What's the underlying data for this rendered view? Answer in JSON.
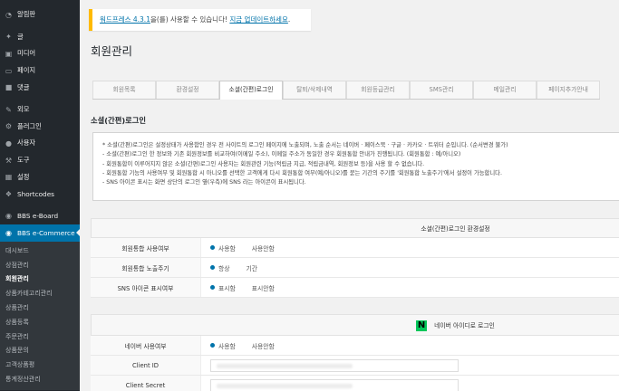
{
  "sidebar": {
    "top_items": [
      {
        "label": "알림판",
        "icon": "dashboard-icon"
      }
    ],
    "items": [
      {
        "label": "글",
        "icon": "pin-icon"
      },
      {
        "label": "미디어",
        "icon": "media-icon"
      },
      {
        "label": "페이지",
        "icon": "page-icon"
      },
      {
        "label": "댓글",
        "icon": "comment-icon"
      }
    ],
    "items2": [
      {
        "label": "외모",
        "icon": "brush-icon"
      },
      {
        "label": "플러그인",
        "icon": "plugin-icon"
      },
      {
        "label": "사용자",
        "icon": "user-icon"
      },
      {
        "label": "도구",
        "icon": "wrench-icon"
      },
      {
        "label": "설정",
        "icon": "settings-icon"
      },
      {
        "label": "Shortcodes",
        "icon": "shortcode-icon"
      }
    ],
    "items3": [
      {
        "label": "BBS e-Board",
        "icon": "board-icon"
      },
      {
        "label": "BBS e-Commerce",
        "icon": "commerce-icon"
      }
    ],
    "submenu": [
      "대시보드",
      "상점관리",
      "회원관리",
      "상품카테고리관리",
      "상품관리",
      "상품등록",
      "주문관리",
      "상품문의",
      "고객상품평",
      "통계정산관리"
    ],
    "submenu_current": "회원관리"
  },
  "notice": {
    "link1": "워드프레스 4.3.1",
    "middle": "을(를) 사용할 수 있습니다!",
    "link2": "지금 업데이트하세요",
    "end": "."
  },
  "page_title": "회원관리",
  "tabs": [
    "회원목록",
    "환경설정",
    "소셜(간편)로그인",
    "탈퇴/삭제내역",
    "회원등급관리",
    "SMS관리",
    "메일관리",
    "페이지추가안내"
  ],
  "active_tab": "소셜(간편)로그인",
  "section_title": "소셜(간편)로그인",
  "description": [
    "* 소셜(간편)로그인은 설정상태가 사용함인 경우 전 사이트의 로그인 페이지에 노출되며, 노출 순서는 네이버 · 페이스북 · 구글 · 카카오 · 트위터 순입니다. (순서변경 불가)",
    "- 소셜(간편)로그인 한 정보와 기존 회원정보를 비교하여(이메일 주소), 이메일 주소가 동일한 경우 회원통합 안내가 진행됩니다. (회원통합 : 예/아니오)",
    "- 회원통합이 이루어지지 않은 소셜(간편)로그인 사용자는 회원관련 기능(적립금 지급, 적립금내역, 회원정보 등)을 사용 할 수 없습니다.",
    "- 회원통합 기능의 사용여부 및 회원통합 시 아니오를 선택한 고객에게 다시 회원통합 여부(예/아니오)를 묻는 기간의 주기를 '회원통합 노출주기'에서 설정이 가능합니다.",
    "- SNS 아이콘 표시는 화면 상단의 로그인 옆(우측)에 SNS 라는 아이콘이 표시됩니다."
  ],
  "env_panel": {
    "title": "소셜(간편)로그인 환경설정",
    "rows": [
      {
        "label": "회원통합 사용여부",
        "options": [
          {
            "text": "사용함",
            "on": true
          },
          {
            "text": "사용안함",
            "on": false
          }
        ]
      },
      {
        "label": "회원통합 노출주기",
        "options": [
          {
            "text": "항상",
            "on": true
          },
          {
            "text": "기간",
            "on": false
          }
        ]
      },
      {
        "label": "SNS 아이콘 표시여부",
        "options": [
          {
            "text": "표시함",
            "on": true
          },
          {
            "text": "표시안함",
            "on": false
          }
        ]
      }
    ]
  },
  "naver_panel": {
    "logo": "N",
    "title": "네이버 아이디로 로그인",
    "use_label": "네이버 사용여부",
    "use_options": [
      {
        "text": "사용함",
        "on": true
      },
      {
        "text": "사용안함",
        "on": false
      }
    ],
    "client_id_label": "Client ID",
    "client_secret_label": "Client Secret"
  },
  "colors": {
    "sidebar_bg": "#23282d",
    "accent": "#0073aa",
    "notice_border": "#ffba00",
    "naver_green": "#03c75a"
  }
}
